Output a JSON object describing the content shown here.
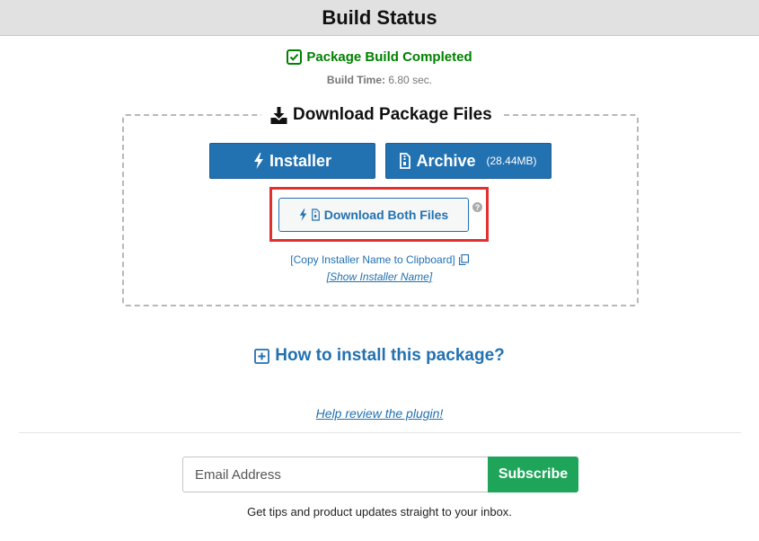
{
  "header": {
    "title": "Build Status"
  },
  "status": {
    "message": "Package Build Completed",
    "build_time_label": "Build Time:",
    "build_time_value": "6.80 sec.",
    "success_color": "#008000"
  },
  "download": {
    "title": "Download Package Files",
    "installer_label": "Installer",
    "archive_label": "Archive",
    "archive_size": "(28.44MB)",
    "both_label": "Download Both Files",
    "help_glyph": "?",
    "copy_label": "[Copy Installer Name to Clipboard]",
    "show_label": "[Show Installer Name]",
    "highlight_color": "#e0302f"
  },
  "howto": {
    "label": "How to install this package?"
  },
  "review": {
    "label": "Help review the plugin!"
  },
  "subscribe": {
    "placeholder": "Email Address",
    "button_label": "Subscribe",
    "tagline": "Get tips and product updates straight to your inbox.",
    "button_color": "#1ea55a"
  },
  "theme": {
    "accent": "#2271b1"
  }
}
